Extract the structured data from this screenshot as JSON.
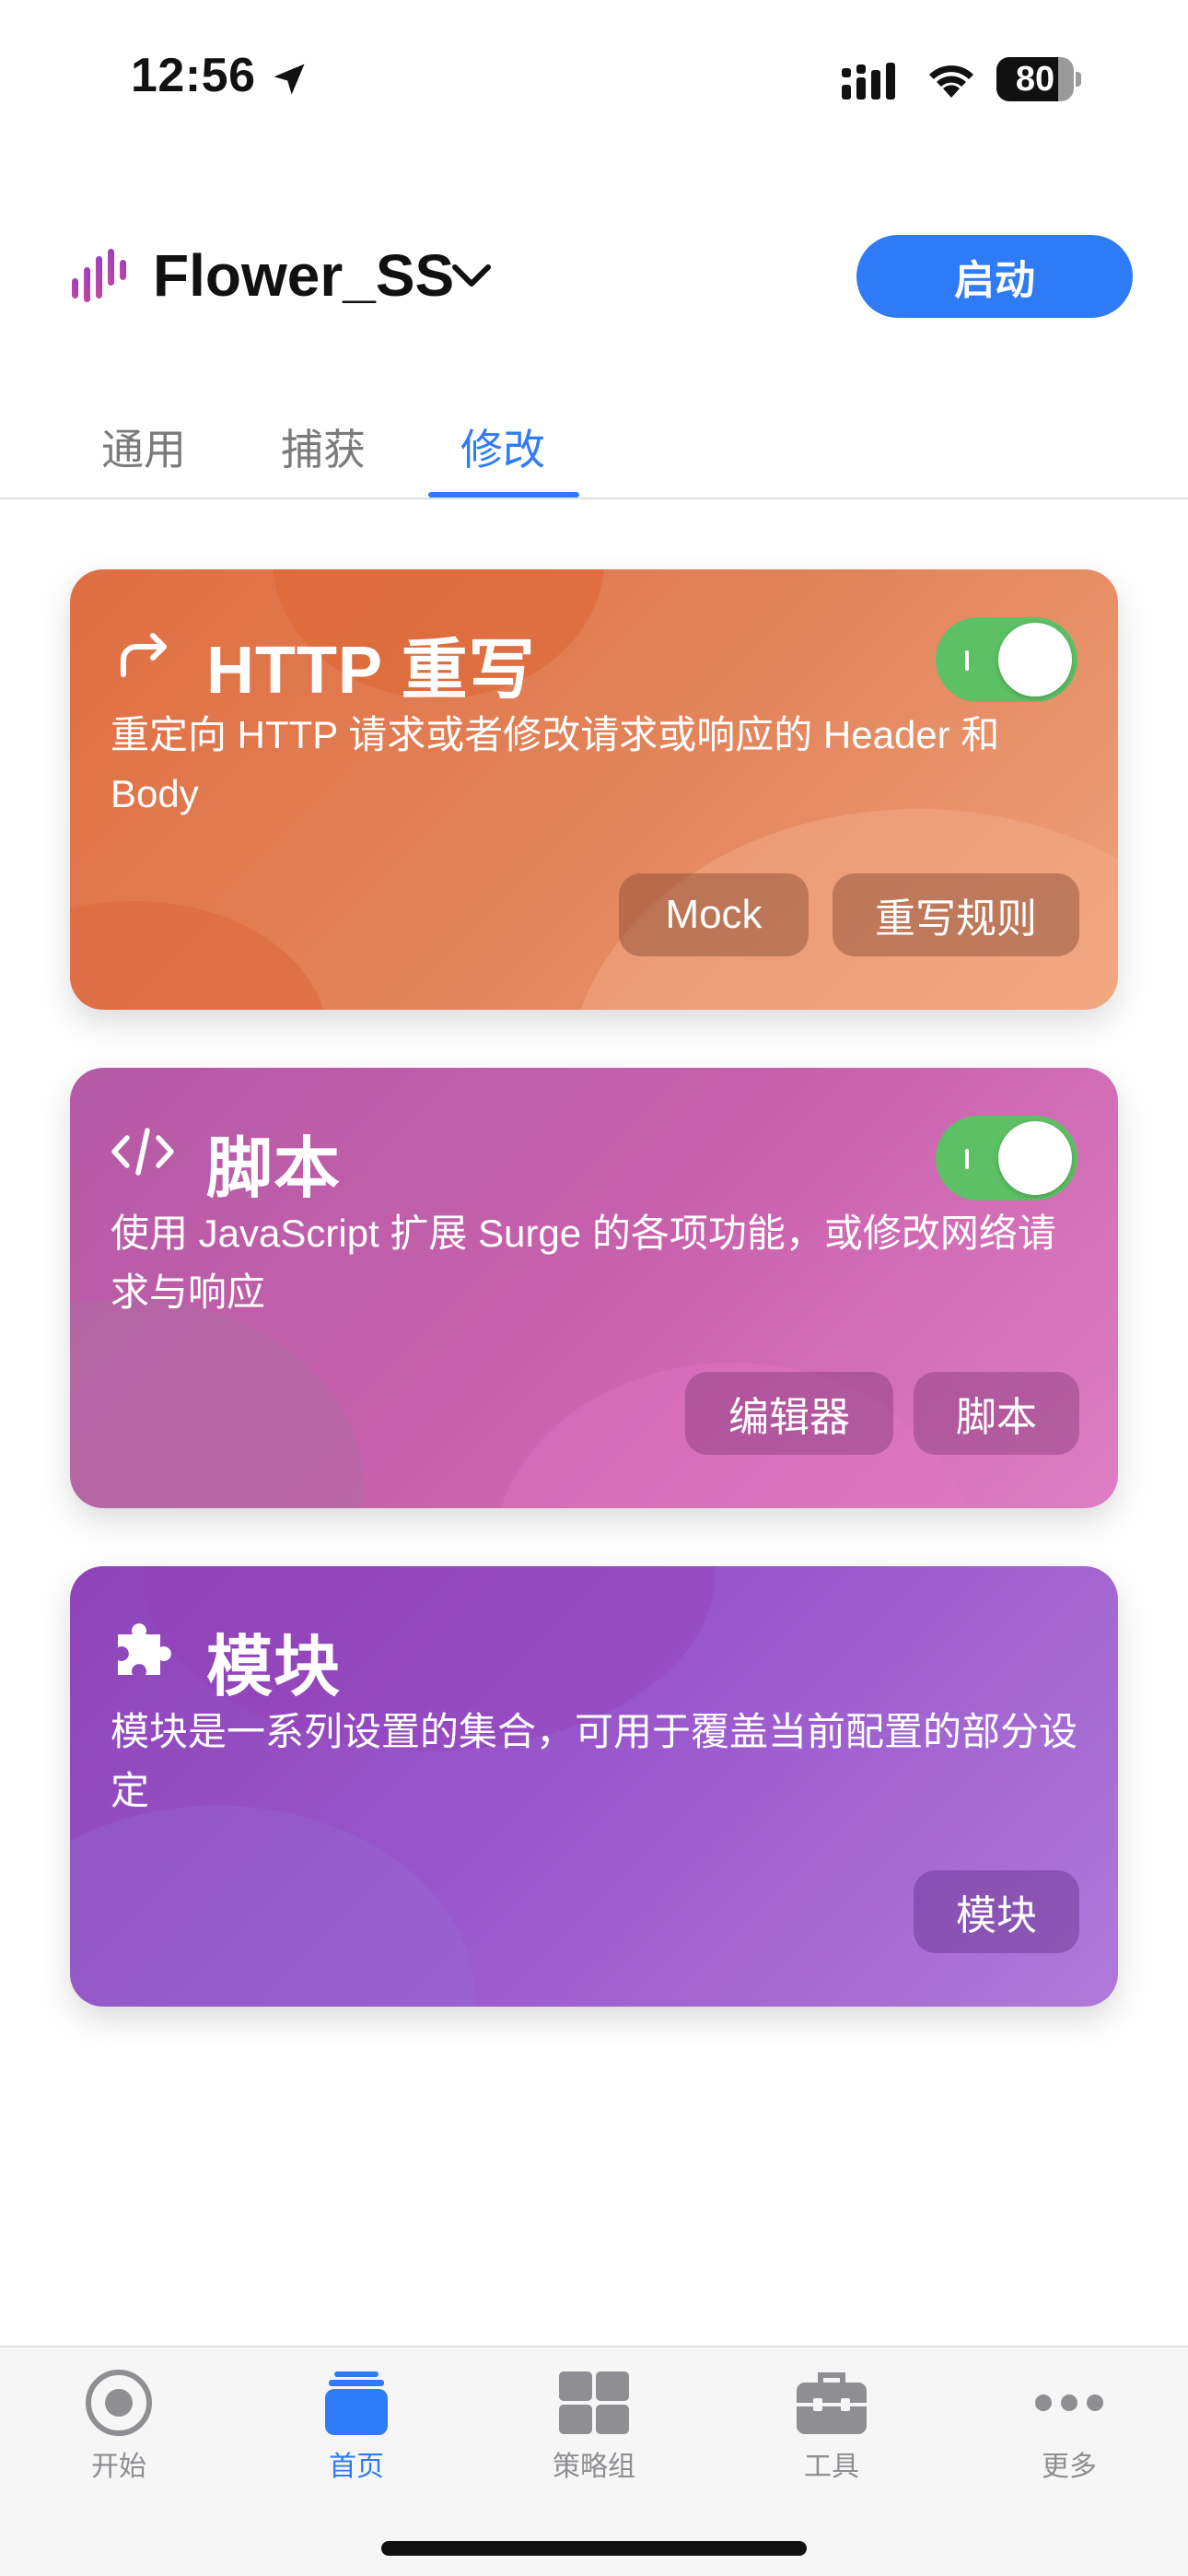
{
  "status_bar": {
    "time": "12:56",
    "battery": "80",
    "battery_level": 0.8
  },
  "header": {
    "profile_name": "Flower_SS",
    "start_button": "启动"
  },
  "tabs": [
    {
      "label": "通用",
      "active": false
    },
    {
      "label": "捕获",
      "active": false
    },
    {
      "label": "修改",
      "active": true
    }
  ],
  "cards": {
    "http": {
      "title": "HTTP 重写",
      "description": "重定向 HTTP 请求或者修改请求或响应的 Header 和 Body",
      "enabled": true,
      "buttons": [
        "Mock",
        "重写规则"
      ],
      "icon": "redo-arrow-icon",
      "color": "#e07a50"
    },
    "script": {
      "title": "脚本",
      "description": "使用 JavaScript 扩展 Surge 的各项功能，或修改网络请求与响应",
      "enabled": true,
      "buttons": [
        "编辑器",
        "脚本"
      ],
      "icon": "code-icon",
      "color": "#c85db0"
    },
    "module": {
      "title": "模块",
      "description": "模块是一系列设置的集合，可用于覆盖当前配置的部分设定",
      "buttons": [
        "模块"
      ],
      "icon": "puzzle-icon",
      "color": "#9a55cf"
    }
  },
  "tab_bar": [
    {
      "label": "开始",
      "icon": "record-icon",
      "active": false
    },
    {
      "label": "首页",
      "icon": "stack-icon",
      "active": true
    },
    {
      "label": "策略组",
      "icon": "grid-icon",
      "active": false
    },
    {
      "label": "工具",
      "icon": "toolbox-icon",
      "active": false
    },
    {
      "label": "更多",
      "icon": "more-icon",
      "active": false
    }
  ],
  "colors": {
    "accent": "#2f7bf5",
    "toggle_on": "#5dc064",
    "inactive": "#8e8e93"
  }
}
